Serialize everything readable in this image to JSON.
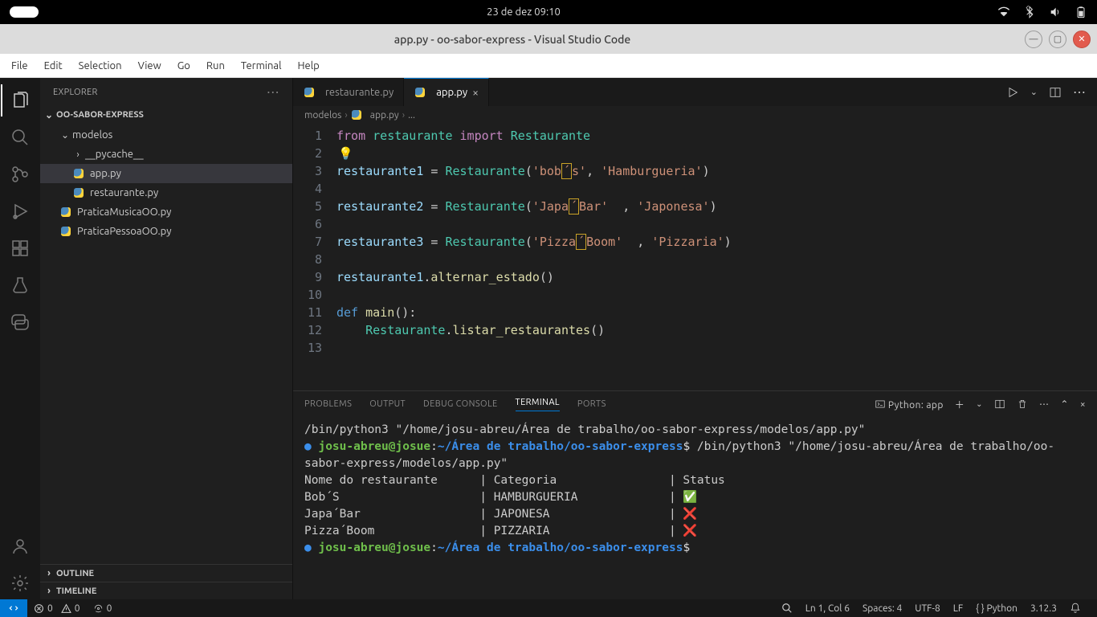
{
  "system": {
    "datetime": "23 de dez  09:10"
  },
  "titlebar": {
    "title": "app.py - oo-sabor-express - Visual Studio Code"
  },
  "menubar": {
    "items": [
      "File",
      "Edit",
      "Selection",
      "View",
      "Go",
      "Run",
      "Terminal",
      "Help"
    ]
  },
  "sidebar": {
    "title": "EXPLORER",
    "project": "OO-SABOR-EXPRESS",
    "tree": {
      "modelos": "modelos",
      "pycache": "__pycache__",
      "app": "app.py",
      "restaurante": "restaurante.py",
      "praticaMusica": "PraticaMusicaOO.py",
      "praticaPessoa": "PraticaPessoaOO.py"
    },
    "outline": "OUTLINE",
    "timeline": "TIMELINE"
  },
  "tabs": {
    "t1": "restaurante.py",
    "t2": "app.py"
  },
  "breadcrumb": {
    "p1": "modelos",
    "p2": "app.py",
    "p3": "..."
  },
  "code": {
    "line_numbers": [
      "1",
      "2",
      "3",
      "4",
      "5",
      "6",
      "7",
      "8",
      "9",
      "10",
      "11",
      "12",
      "13"
    ],
    "l1_from": "from",
    "l1_mod": " restaurante ",
    "l1_import": "import",
    "l1_cls": " Restaurante",
    "l3_v": "restaurante1 ",
    "l3_eq": "= ",
    "l3_cls": "Restaurante",
    "l3_p": "(",
    "l3_s1a": "'bob",
    "l3_s1b": "´",
    "l3_s1c": "s'",
    "l3_c": ", ",
    "l3_s2": "'Hamburgueria'",
    "l3_pe": ")",
    "l5_v": "restaurante2 ",
    "l5_cls": "Restaurante",
    "l5_s1a": "'Japa",
    "l5_s1b": "´",
    "l5_s1c": "Bar'",
    "l5_c": "  , ",
    "l5_s2": "'Japonesa'",
    "l7_v": "restaurante3 ",
    "l7_cls": "Restaurante",
    "l7_s1a": "'Pizza",
    "l7_s1b": "´",
    "l7_s1c": "Boom'",
    "l7_c": "  , ",
    "l7_s2": "'Pizzaria'",
    "l9_v": "restaurante1",
    "l9_dot": ".",
    "l9_fn": "alternar_estado",
    "l9_p": "()",
    "l11_def": "def",
    "l11_fn": " main",
    "l11_p": "():",
    "l12_cls": "    Restaurante",
    "l12_dot": ".",
    "l12_fn": "listar_restaurantes",
    "l12_p": "()"
  },
  "panel": {
    "tabs": {
      "problems": "PROBLEMS",
      "output": "OUTPUT",
      "debug": "DEBUG CONSOLE",
      "terminal": "TERMINAL",
      "ports": "PORTS"
    },
    "termLabel": "Python: app"
  },
  "terminal": {
    "line1": "/bin/python3 \"/home/josu-abreu/Área de trabalho/oo-sabor-express/modelos/app.py\"",
    "prompt_user": "josu-abreu@josue",
    "prompt_colon": ":",
    "prompt_path": "~/Área de trabalho/oo-sabor-express",
    "prompt_dollar": "$",
    "cmd2": " /bin/python3 \"/home/josu-abreu/Área de trabalho/oo-sabor-express/modelos/app.py\"",
    "header": "Nome do restaurante      | Categoria                | Status",
    "row1": "Bob´S                    | HAMBURGUERIA             | ✅",
    "row2": "Japa´Bar                 | JAPONESA                 | ❌",
    "row3": "Pizza´Boom               | PIZZARIA                 | ❌"
  },
  "statusbar": {
    "errors": "0",
    "warnings": "0",
    "ports": "0",
    "lncol": "Ln 1, Col 6",
    "spaces": "Spaces: 4",
    "encoding": "UTF-8",
    "eol": "LF",
    "lang": "{ } Python",
    "pyver": "3.12.3"
  }
}
